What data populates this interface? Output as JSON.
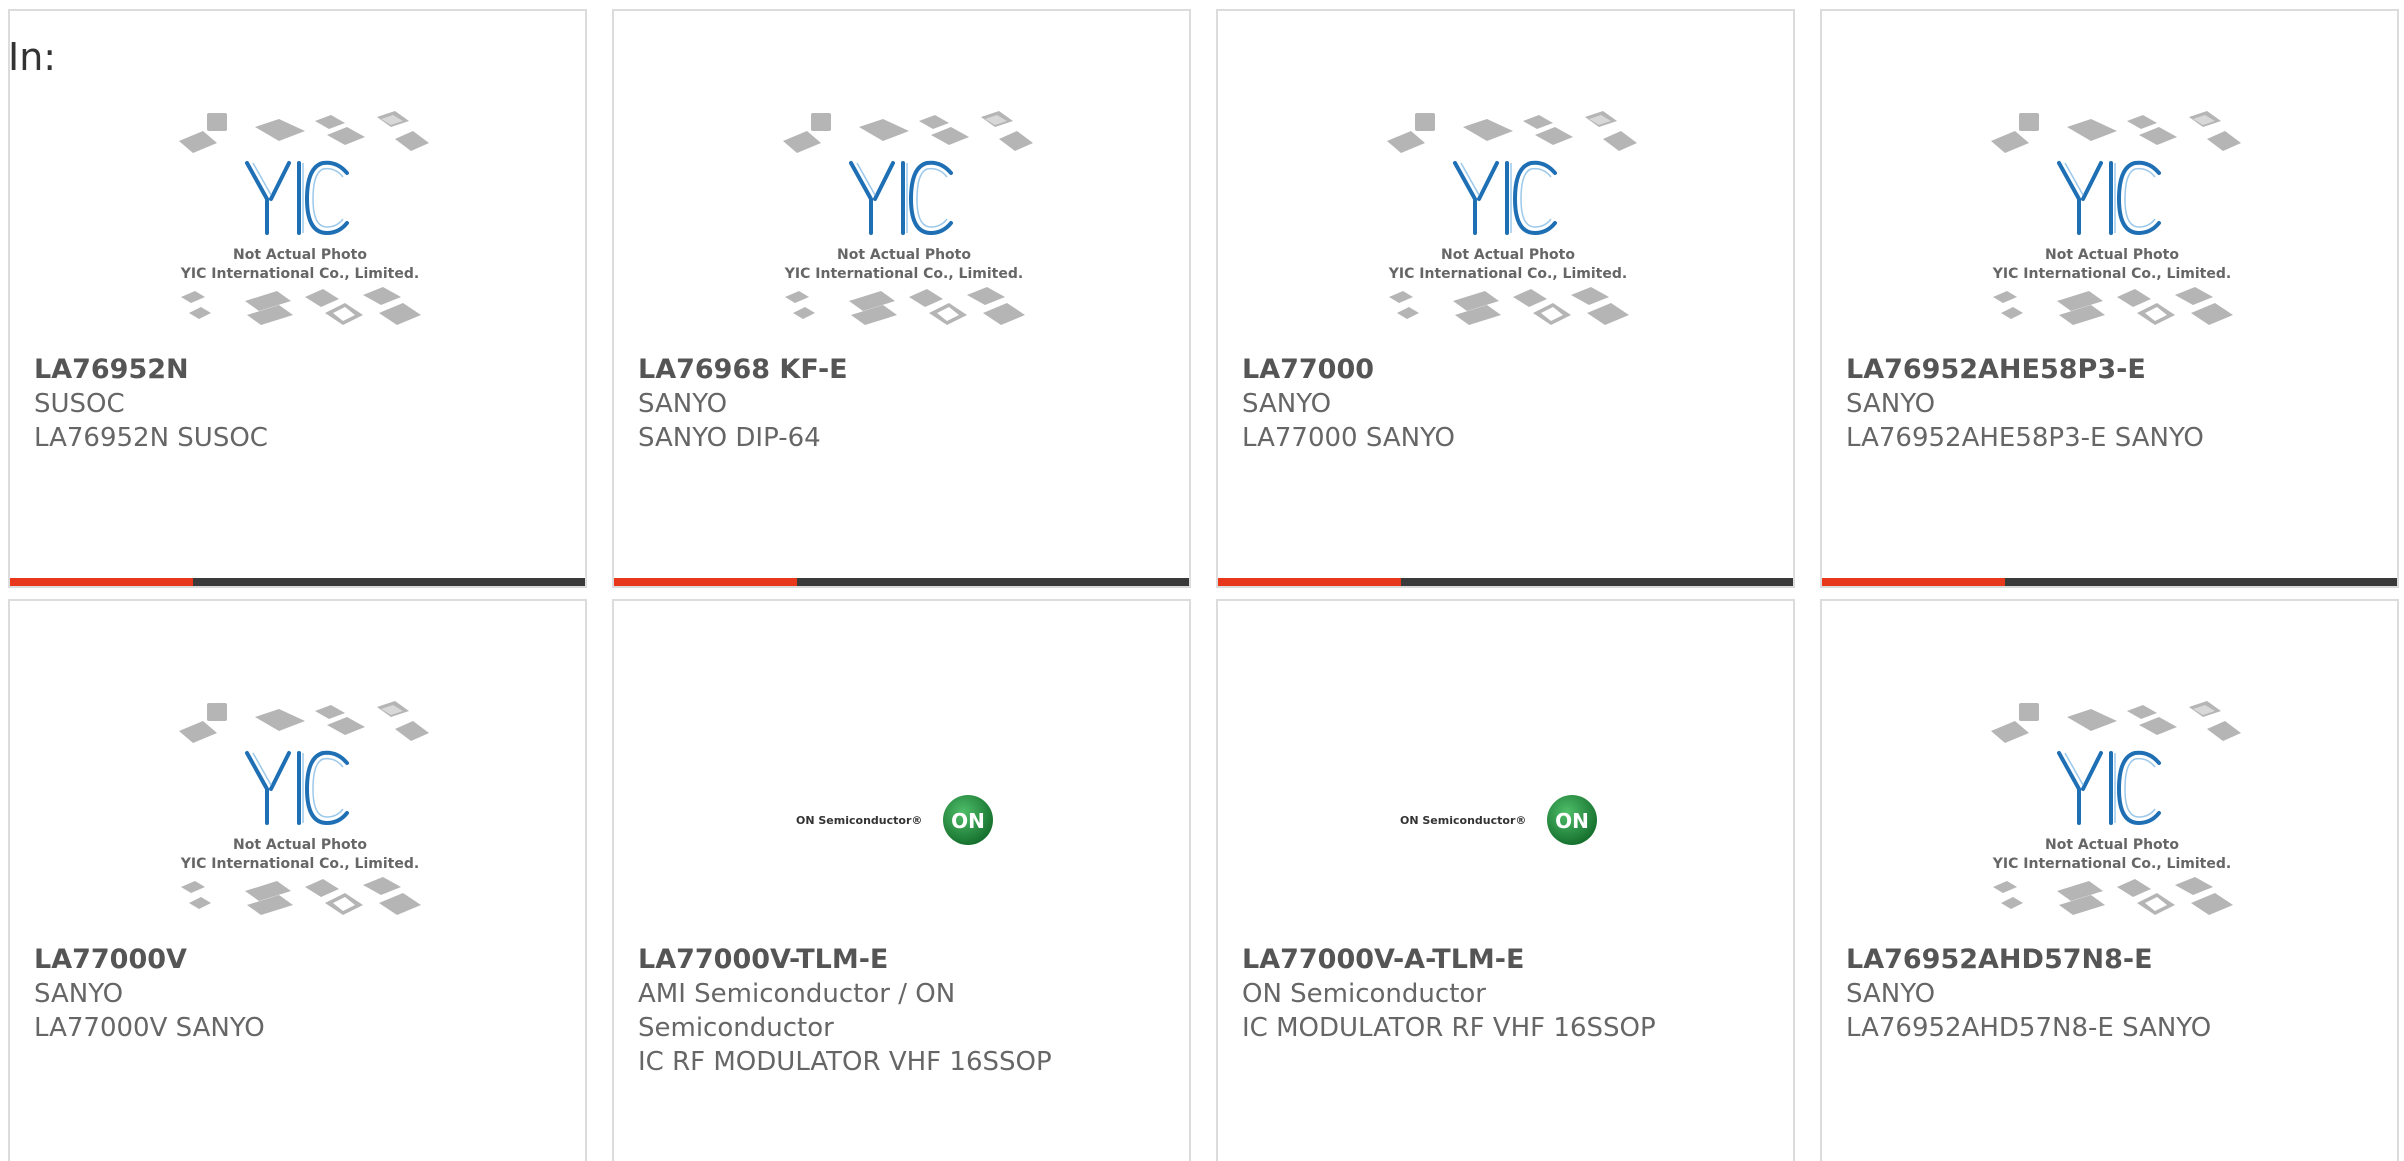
{
  "header": {
    "in_label": "In:"
  },
  "placeholder": {
    "line1": "Not Actual Photo",
    "line2": "YIC International Co., Limited.",
    "logo_text": "YIC"
  },
  "on_logo": {
    "company": "ON Semiconductor",
    "badge": "ON"
  },
  "colors": {
    "accent": "#e8381b",
    "bar": "#3a3a3a",
    "logo_blue": "#1f6fb5",
    "on_green": "#1e8a3c"
  },
  "products": [
    {
      "part": "LA76952N",
      "maker": "SUSOC",
      "desc": "LA76952N SUSOC",
      "image": "yic-placeholder"
    },
    {
      "part": "LA76968 KF-E",
      "maker": "SANYO",
      "desc": "SANYO DIP-64",
      "image": "yic-placeholder"
    },
    {
      "part": "LA77000",
      "maker": "SANYO",
      "desc": "LA77000 SANYO",
      "image": "yic-placeholder"
    },
    {
      "part": "LA76952AHE58P3-E",
      "maker": "SANYO",
      "desc": "LA76952AHE58P3-E SANYO",
      "image": "yic-placeholder"
    },
    {
      "part": "LA77000V",
      "maker": "SANYO",
      "desc": "LA77000V SANYO",
      "image": "yic-placeholder"
    },
    {
      "part": "LA77000V-TLM-E",
      "maker": "AMI Semiconductor / ON Semiconductor",
      "desc": "IC RF MODULATOR VHF 16SSOP",
      "image": "on-semi-logo"
    },
    {
      "part": "LA77000V-A-TLM-E",
      "maker": "ON Semiconductor",
      "desc": "IC MODULATOR RF VHF 16SSOP",
      "image": "on-semi-logo"
    },
    {
      "part": "LA76952AHD57N8-E",
      "maker": "SANYO",
      "desc": "LA76952AHD57N8-E SANYO",
      "image": "yic-placeholder"
    }
  ]
}
